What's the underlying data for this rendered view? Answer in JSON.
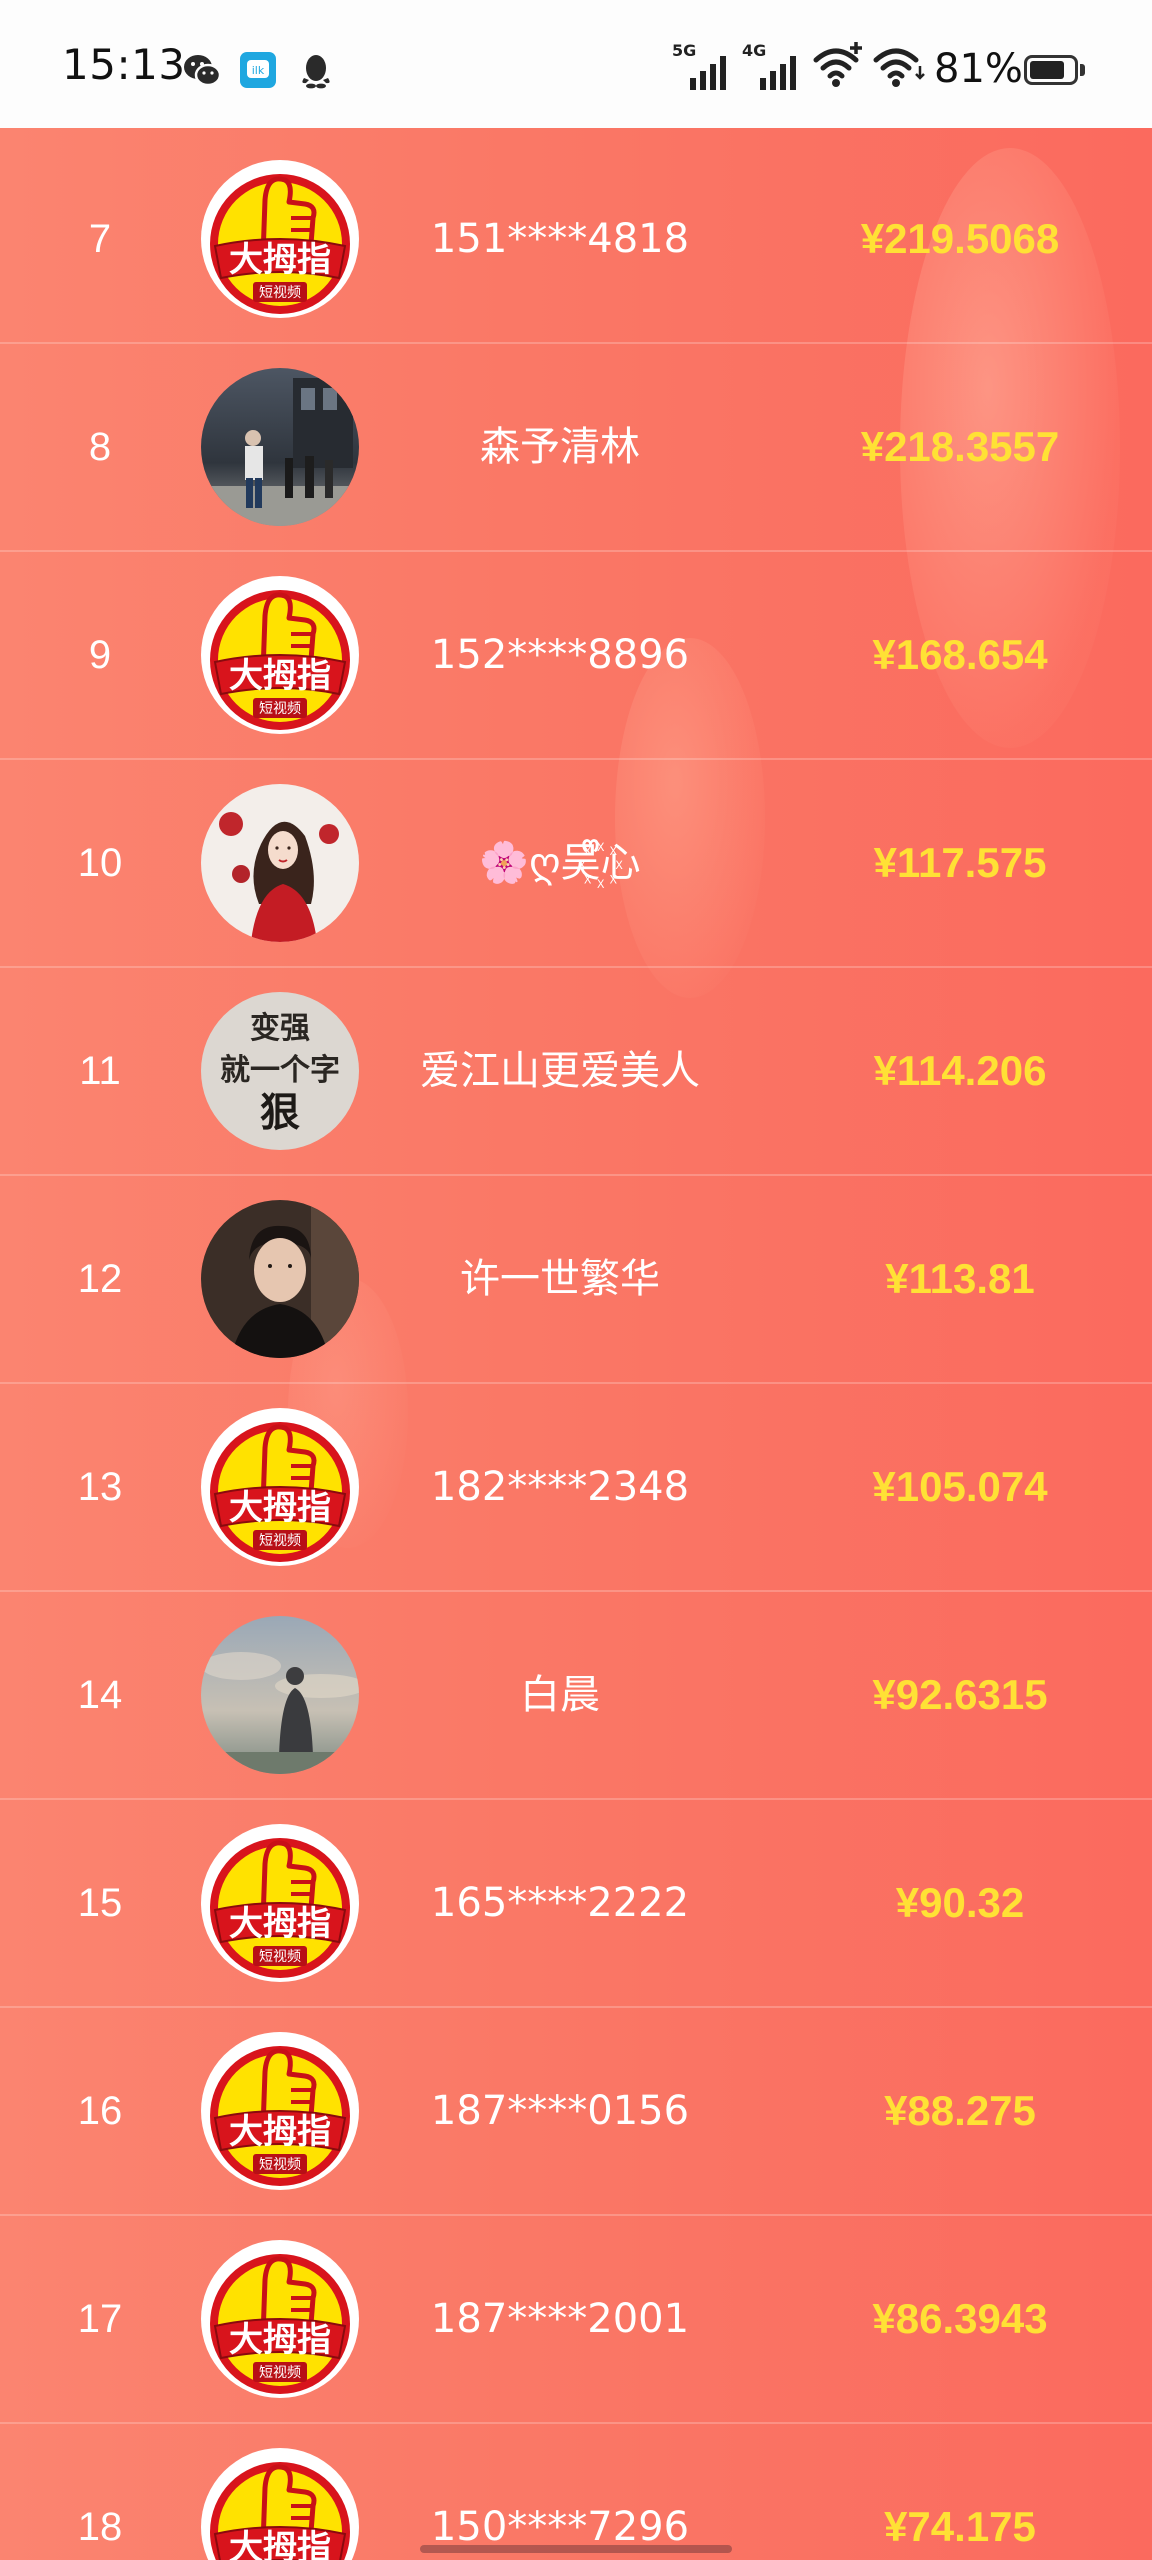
{
  "status_bar": {
    "time": "15:13",
    "notification_icons": [
      "wechat-icon",
      "lark-icon",
      "qq-icon"
    ],
    "signal_1_label": "5G",
    "signal_2_label": "4G",
    "battery_percent": "81%",
    "battery_level": 0.81
  },
  "ranking": {
    "rows": [
      {
        "rank": "7",
        "avatar": "dalmuzhi-logo",
        "name": "151****4818",
        "amount": "¥219.5068"
      },
      {
        "rank": "8",
        "avatar": "street-photo",
        "name": "森予清林",
        "amount": "¥218.3557"
      },
      {
        "rank": "9",
        "avatar": "dalmuzhi-logo",
        "name": "152****8896",
        "amount": "¥168.654"
      },
      {
        "rank": "10",
        "avatar": "girl-portrait",
        "name": "🌸ღ吴ᩚ꙰ᩚ心",
        "amount": "¥117.575"
      },
      {
        "rank": "11",
        "avatar": "text-avatar",
        "name": "爱江山更爱美人",
        "amount": "¥114.206"
      },
      {
        "rank": "12",
        "avatar": "man-portrait",
        "name": "许一世繁华",
        "amount": "¥113.81"
      },
      {
        "rank": "13",
        "avatar": "dalmuzhi-logo",
        "name": "182****2348",
        "amount": "¥105.074"
      },
      {
        "rank": "14",
        "avatar": "sky-photo",
        "name": "白晨",
        "amount": "¥92.6315"
      },
      {
        "rank": "15",
        "avatar": "dalmuzhi-logo",
        "name": "165****2222",
        "amount": "¥90.32"
      },
      {
        "rank": "16",
        "avatar": "dalmuzhi-logo",
        "name": "187****0156",
        "amount": "¥88.275"
      },
      {
        "rank": "17",
        "avatar": "dalmuzhi-logo",
        "name": "187****2001",
        "amount": "¥86.3943"
      },
      {
        "rank": "18",
        "avatar": "dalmuzhi-logo",
        "name": "150****7296",
        "amount": "¥74.175"
      }
    ],
    "logo": {
      "main": "大拇指",
      "sub": "短视频"
    },
    "text_avatar": {
      "line1": "变强",
      "line2": "就一个字",
      "line3": "狠"
    }
  },
  "colors": {
    "amount": "#ffe135",
    "background_start": "#fb8470",
    "background_end": "#fb6a5e",
    "logo_red": "#d8141c",
    "logo_yellow": "#ffe200"
  }
}
